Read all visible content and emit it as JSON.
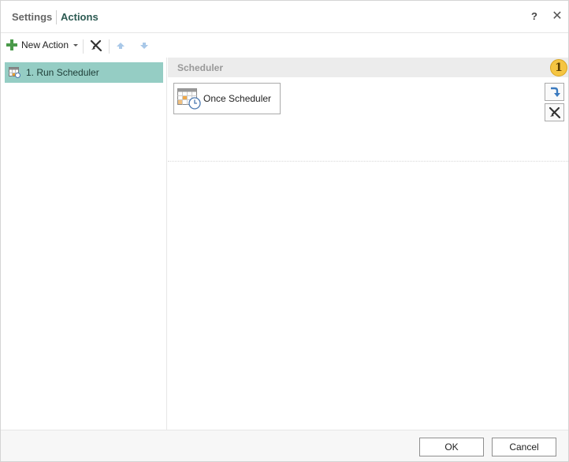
{
  "title": {
    "breadcrumb_parent": "Settings",
    "breadcrumb_current": "Actions",
    "help_label": "?",
    "close_label": "✕"
  },
  "toolbar": {
    "new_action_label": "New Action",
    "icons": [
      "plus-icon",
      "chevron-down-icon",
      "clear-icon",
      "move-up-icon",
      "move-down-icon"
    ]
  },
  "tree": {
    "items": [
      {
        "label": "1. Run Scheduler",
        "selected": true,
        "icon": "scheduler-icon"
      }
    ]
  },
  "section": {
    "title": "Scheduler",
    "step_number": "1",
    "card": {
      "label": "Once Scheduler",
      "icon": "calendar-clock-icon"
    },
    "side_icons": [
      "insert-arrow-icon",
      "clear-icon"
    ]
  },
  "footer": {
    "ok_label": "OK",
    "cancel_label": "Cancel"
  },
  "colors": {
    "selected_bg": "#95cdc4",
    "accent_text": "#2c5a52",
    "badge": "#f5c542",
    "plus_green": "#4a9a4a",
    "arrow_blue": "#3b7bbf"
  }
}
